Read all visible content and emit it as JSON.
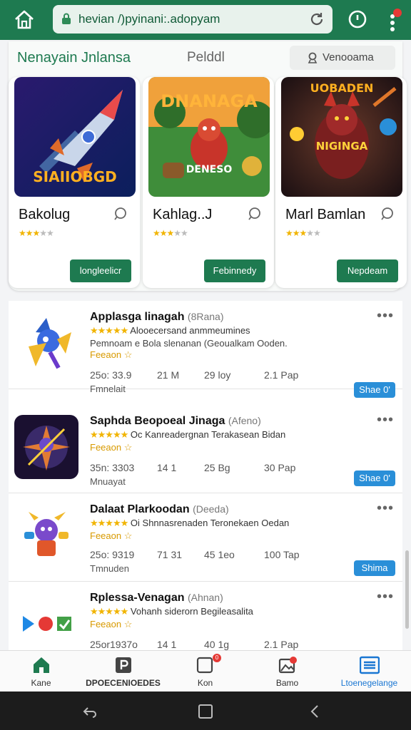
{
  "browser": {
    "url": "hevian /)pyinani:.adopyam",
    "colors": {
      "bar": "#1e7a50",
      "url_bg": "#e8f2ec"
    }
  },
  "featured": {
    "title": "Nenayain  Jnlansa",
    "subtitle": "Pelddl",
    "search_label": "Venooama",
    "games": [
      {
        "name": "Bakolug",
        "stars": "★★★☆☆",
        "button": "longleelicr",
        "thumb_text": "SIAIIOBGD"
      },
      {
        "name": "Kahlag..J",
        "stars": "★★★☆☆",
        "button": "Febinnedy",
        "thumb_text": "DNANAGA",
        "thumb_text2": "DENESO"
      },
      {
        "name": "Marl Bamlan",
        "stars": "★★★☆☆",
        "button": "Nepdeam",
        "thumb_text": "UOBADEN",
        "thumb_text2": "NIGINGA"
      }
    ]
  },
  "apps": [
    {
      "name": "Applasga linagah",
      "sub": "(8Rana)",
      "stars": "★★★★★",
      "desc": "Alooecersand anmmeumines",
      "desc2": "Pemnoam e Bola slenanan (Geoualkam Ooden.",
      "tag": "Feeaon ☆",
      "stats": [
        "25o: 33.9",
        "21 M",
        "29 loy",
        "2.1 Pap"
      ],
      "extra": "Fmnelait",
      "button": "Shae 0'"
    },
    {
      "name": "Saphda Beopoeal Jinaga",
      "sub": "(Afeno)",
      "stars": "★★★★★",
      "desc": "Oc Kanreadergnan Terakasean Bidan",
      "desc2": "",
      "tag": "Feeaon ☆",
      "stats": [
        "35n: 3303",
        "14 1",
        "25 Bg",
        "30 Pap"
      ],
      "extra": "Mnuayat",
      "button": "Shae 0'"
    },
    {
      "name": "Dalaat Plarkoodan",
      "sub": "(Deeda)",
      "stars": "★★★★★",
      "desc": "Oi Shnnasrenaden Teronekaen Oedan",
      "desc2": "",
      "tag": "Feeaon ☆",
      "stats": [
        "25o: 9319",
        "71 31",
        "45 1eo",
        "100 Tap"
      ],
      "extra": "Tmnuden",
      "button": "Shima"
    },
    {
      "name": "Rplessa-Venagan",
      "sub": "(Ahnan)",
      "stars": "★★★★★",
      "desc": "Vohanh siderorn Begileasalita",
      "desc2": "",
      "tag": "Feeaon ☆",
      "stats": [
        "25or1937o",
        "14 1",
        "40 1g",
        "2.1 Pap"
      ],
      "extra": "",
      "button": ""
    }
  ],
  "bottom_nav": [
    {
      "label": "Kane",
      "icon": "home-icon"
    },
    {
      "label": "DPOECENIOEDES",
      "icon": "p-box-icon"
    },
    {
      "label": "Kon",
      "icon": "square-badge-icon",
      "badge": "0"
    },
    {
      "label": "Bamo",
      "icon": "image-pin-icon"
    },
    {
      "label": "Ltoenegelange",
      "icon": "menu-list-icon",
      "active": true
    }
  ]
}
